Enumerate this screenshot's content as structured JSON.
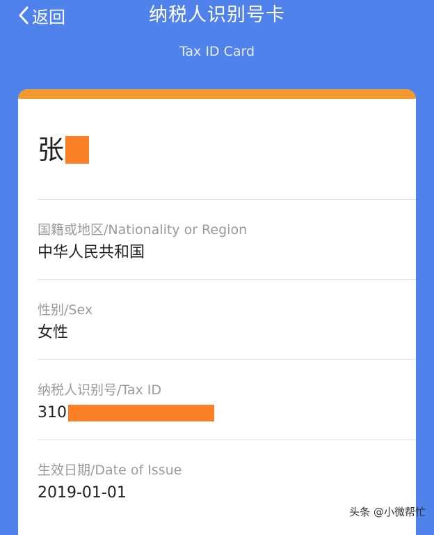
{
  "header": {
    "back_label": "返回",
    "title": "纳税人识别号卡",
    "subtitle": "Tax ID Card"
  },
  "card": {
    "name_visible": "张",
    "fields": [
      {
        "label": "国籍或地区/Nationality or Region",
        "value": "中华人民共和国"
      },
      {
        "label": "性别/Sex",
        "value": "女性"
      },
      {
        "label": "纳税人识别号/Tax ID",
        "value": "310"
      },
      {
        "label": "生效日期/Date of Issue",
        "value": "2019-01-01"
      }
    ]
  },
  "watermark": "头条 @小微帮忙",
  "colors": {
    "background": "#4f82ea",
    "accent_bar": "#f29a2e",
    "redaction": "#fb7f25"
  },
  "icons": {
    "back": "chevron-left-icon"
  }
}
